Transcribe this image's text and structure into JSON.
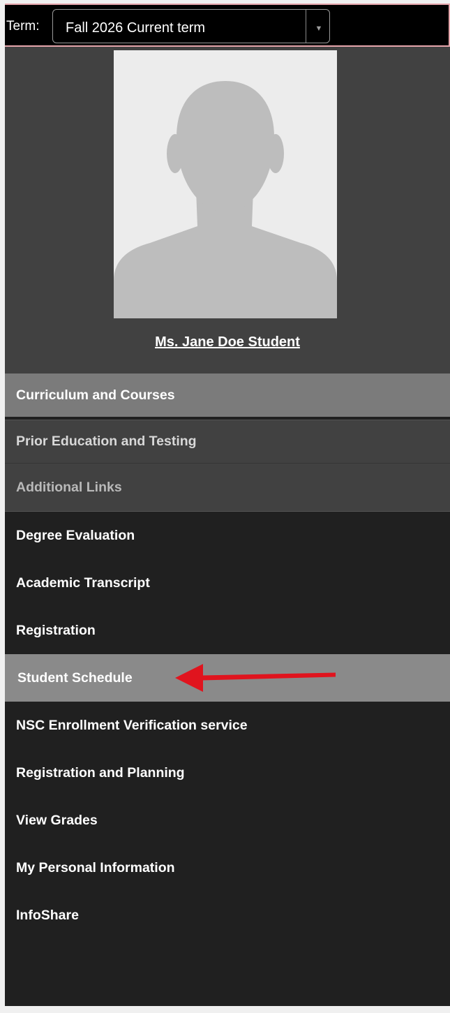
{
  "term": {
    "label": "Term:",
    "selected": "Fall 2026 Current term"
  },
  "profile": {
    "name": "Ms. Jane Doe Student"
  },
  "sections": {
    "curriculum": "Curriculum and Courses",
    "prior": "Prior Education and Testing",
    "additional": "Additional Links"
  },
  "links": [
    "Degree Evaluation",
    "Academic Transcript",
    "Registration",
    "Student Schedule",
    "NSC Enrollment Verification service",
    "Registration and Planning",
    "View Grades",
    "My Personal Information",
    "InfoShare"
  ],
  "colors": {
    "annotation_arrow": "#e0141e",
    "active_item_bg": "#8a8a8a",
    "sidebar_bg": "#202020"
  }
}
